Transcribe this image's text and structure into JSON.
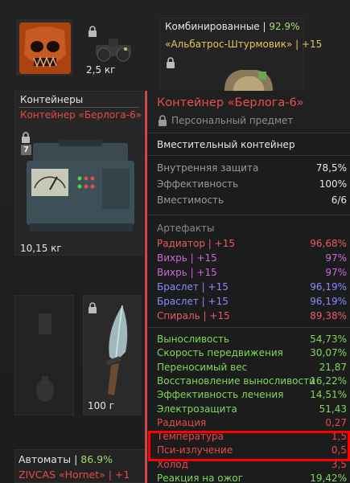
{
  "inventory": {
    "nvg_weight": "2,5 кг",
    "armor": {
      "category": "Комбинированные",
      "separator": " | ",
      "percent": "92.9%",
      "name": "«Альбатрос-Штурмовик» | +15"
    },
    "container": {
      "category": "Контейнеры",
      "name": "Контейнер «Берлога-6»",
      "badge": "7",
      "weight": "10,15 кг"
    },
    "knife_weight": "100 г",
    "rifle": {
      "category": "Автоматы",
      "separator": " | ",
      "percent": "86.9%",
      "name": "ZIVCAS «Hornet» | +1"
    }
  },
  "tooltip": {
    "title": "Контейнер «Берлога-6»",
    "subtitle": "Персональный предмет",
    "description": "Вместительный контейнер",
    "base_stats": [
      {
        "key": "Внутренняя защита",
        "value": "78,5%"
      },
      {
        "key": "Эффективность",
        "value": "100%"
      },
      {
        "key": "Вместимость",
        "value": "6/6"
      }
    ],
    "artifacts_label": "Артефакты",
    "artifacts": [
      {
        "key": "Радиатор | +15",
        "value": "96,68%",
        "color": "#e85a6a"
      },
      {
        "key": "Вихрь | +15",
        "value": "97%",
        "color": "#c86ad8"
      },
      {
        "key": "Вихрь | +15",
        "value": "97%",
        "color": "#c86ad8"
      },
      {
        "key": "Браслет | +15",
        "value": "96,19%",
        "color": "#8a8aff"
      },
      {
        "key": "Браслет | +15",
        "value": "96,19%",
        "color": "#8a8aff"
      },
      {
        "key": "Спираль | +15",
        "value": "89,38%",
        "color": "#e85a6a"
      }
    ],
    "effects": [
      {
        "key": "Выносливость",
        "value": "54,73%",
        "color": "#7ed957"
      },
      {
        "key": "Скорость передвижения",
        "value": "30,07%",
        "color": "#7ed957"
      },
      {
        "key": "Переносимый вес",
        "value": "21,87",
        "color": "#7ed957"
      },
      {
        "key": "Восстановление выносливости",
        "value": "16,22%",
        "color": "#7ed957"
      },
      {
        "key": "Эффективность лечения",
        "value": "14,51%",
        "color": "#7ed957"
      },
      {
        "key": "Электрозащита",
        "value": "51,43",
        "color": "#7ed957"
      },
      {
        "key": "Радиация",
        "value": "0,27",
        "color": "#e84a4a"
      },
      {
        "key": "Температура",
        "value": "1,5",
        "color": "#e84a4a"
      },
      {
        "key": "Пси-излучение",
        "value": "0,5",
        "color": "#e84a4a"
      },
      {
        "key": "Холод",
        "value": "3,5",
        "color": "#e84a4a"
      },
      {
        "key": "Реакция на ожог",
        "value": "19,42%",
        "color": "#7ed957"
      }
    ]
  }
}
